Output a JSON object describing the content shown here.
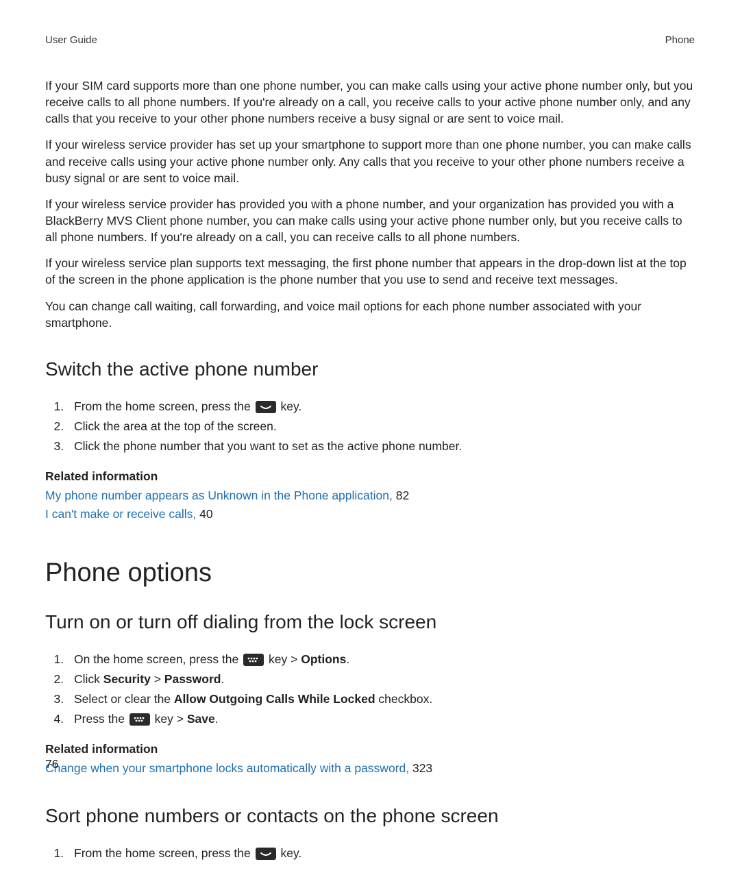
{
  "header": {
    "left": "User Guide",
    "right": "Phone"
  },
  "paragraphs": {
    "p1": "If your SIM card supports more than one phone number, you can make calls using your active phone number only, but you receive calls to all phone numbers. If you're already on a call, you receive calls to your active phone number only, and any calls that you receive to your other phone numbers receive a busy signal or are sent to voice mail.",
    "p2": "If your wireless service provider has set up your smartphone to support more than one phone number, you can make calls and receive calls using your active phone number only. Any calls that you receive to your other phone numbers receive a busy signal or are sent to voice mail.",
    "p3": "If your wireless service provider has provided you with a phone number, and your organization has provided you with a BlackBerry MVS Client phone number, you can make calls using your active phone number only, but you receive calls to all phone numbers. If you're already on a call, you can receive calls to all phone numbers.",
    "p4": "If your wireless service plan supports text messaging, the first phone number that appears in the drop-down list at the top of the screen in the phone application is the phone number that you use to send and receive text messages.",
    "p5": "You can change call waiting, call forwarding, and voice mail options for each phone number associated with your smartphone."
  },
  "section1": {
    "title": "Switch the active phone number",
    "steps": {
      "s1a": "From the home screen, press the ",
      "s1b": " key.",
      "s2": "Click the area at the top of the screen.",
      "s3": "Click the phone number that you want to set as the active phone number."
    },
    "related_label": "Related information",
    "related": [
      {
        "text": "My phone number appears as Unknown in the Phone application,",
        "page": " 82"
      },
      {
        "text": "I can't make or receive calls,",
        "page": " 40"
      }
    ]
  },
  "chapter": {
    "title": "Phone options"
  },
  "section2": {
    "title": "Turn on or turn off dialing from the lock screen",
    "steps": {
      "s1a": "On the home screen, press the ",
      "s1b": " key > ",
      "s1c": "Options",
      "s1d": ".",
      "s2a": "Click ",
      "s2b": "Security",
      "s2c": " > ",
      "s2d": "Password",
      "s2e": ".",
      "s3a": "Select or clear the ",
      "s3b": "Allow Outgoing Calls While Locked",
      "s3c": " checkbox.",
      "s4a": "Press the ",
      "s4b": " key > ",
      "s4c": "Save",
      "s4d": "."
    },
    "related_label": "Related information",
    "related": [
      {
        "text": "Change when your smartphone locks automatically with a password,",
        "page": " 323"
      }
    ]
  },
  "section3": {
    "title": "Sort phone numbers or contacts on the phone screen",
    "steps": {
      "s1a": "From the home screen, press the ",
      "s1b": " key."
    }
  },
  "page_number": "76"
}
